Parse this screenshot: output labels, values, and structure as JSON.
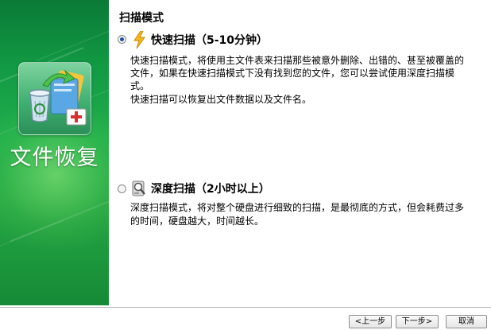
{
  "banner": {
    "title": "文件恢复",
    "icon": "recycle-bin-folder-icon",
    "color": "#1fae4c"
  },
  "section_title": "扫描模式",
  "options": [
    {
      "title": "快速扫描（5-10分钟）",
      "selected": true,
      "icon": "lightning-icon",
      "description_lines": [
        "快速扫描模式，将使用主文件表来扫描那些被意外删除、出错的、甚至被覆盖的",
        "文件，如果在快速扫描模式下没有找到您的文件，您可以尝试使用深度扫描模",
        "式。",
        "快速扫描可以恢复出文件数据以及文件名。"
      ]
    },
    {
      "title": "深度扫描（2小时以上）",
      "selected": false,
      "icon": "disk-magnifier-icon",
      "description_lines": [
        "深度扫描模式，将对整个硬盘进行细致的扫描，是最彻底的方式，但会耗费过多",
        "的时间，硬盘越大，时间越长。"
      ]
    }
  ],
  "buttons": {
    "prev": "<上一步",
    "next": "下一步>",
    "cancel": "取消"
  }
}
